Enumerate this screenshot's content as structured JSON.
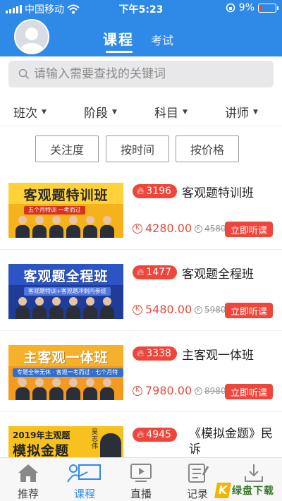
{
  "status": {
    "carrier": "中国移动",
    "time": "下午5:23",
    "battery": "9%"
  },
  "header": {
    "tab_course": "课程",
    "tab_exam": "考试"
  },
  "search": {
    "placeholder": "请输入需要查找的关键词"
  },
  "filters": [
    "班次",
    "阶段",
    "科目",
    "讲师"
  ],
  "sort": [
    "关注度",
    "按时间",
    "按价格"
  ],
  "colors": {
    "brand": "#2f8ae7",
    "accent": "#f0453a"
  },
  "courses": [
    {
      "thumb_title": "客观题特训班",
      "thumb_sub": "五个月特训  一考而过",
      "hot": "3196",
      "name": "客观题特训班",
      "price": "4280.00",
      "old_price": "4580",
      "buy": "立即听课"
    },
    {
      "thumb_title": "客观题全程班",
      "thumb_sub": "客观题特训+客观题冲刺内参班",
      "hot": "1477",
      "name": "客观题全程班",
      "price": "5480.00",
      "old_price": "5980",
      "buy": "立即听课"
    },
    {
      "thumb_title": "主客观一体班",
      "thumb_sub": "专题全年无休 · 客观一考而过 · 七个月特训",
      "hot": "3338",
      "name": "主客观一体班",
      "price": "7980.00",
      "old_price": "8980",
      "buy": "立即听课"
    },
    {
      "thumb_title": "模拟金题",
      "thumb_year": "2019年主观题",
      "thumb_teacher": "吴志伟",
      "hot": "4945",
      "name": "《模拟金题》民诉"
    }
  ],
  "nav": [
    "推荐",
    "课程",
    "直播",
    "记录",
    "下载"
  ],
  "watermark": {
    "mark": "K",
    "text": "绿盘下载"
  }
}
